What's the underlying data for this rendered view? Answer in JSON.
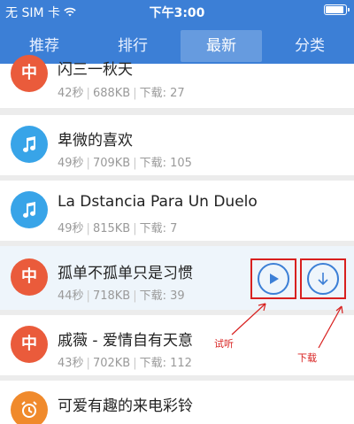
{
  "status_bar": {
    "carrier": "无 SIM 卡",
    "time": "下午3:00",
    "battery_level": 0.9
  },
  "tabs": [
    {
      "label": "推荐",
      "active": false
    },
    {
      "label": "排行",
      "active": false
    },
    {
      "label": "最新",
      "active": true
    },
    {
      "label": "分类",
      "active": false
    }
  ],
  "items": [
    {
      "title": "闪三一秋天",
      "duration": "42秒",
      "size": "688KB",
      "downloads": "下载: 27",
      "icon": "zhong-icon",
      "icon_color": "#ea5b3b"
    },
    {
      "title": "卑微的喜欢",
      "duration": "49秒",
      "size": "709KB",
      "downloads": "下载: 105",
      "icon": "music-note-icon",
      "icon_color": "#38a4e8"
    },
    {
      "title": "La Dstancia Para Un Duelo",
      "duration": "49秒",
      "size": "815KB",
      "downloads": "下载: 7",
      "icon": "music-note-icon",
      "icon_color": "#38a4e8"
    },
    {
      "title": "孤单不孤单只是习惯",
      "duration": "44秒",
      "size": "718KB",
      "downloads": "下载: 39",
      "icon": "zhong-icon",
      "icon_color": "#ea5b3b"
    },
    {
      "title": "戚薇 - 爱情自有天意",
      "duration": "43秒",
      "size": "702KB",
      "downloads": "下载: 112",
      "icon": "zhong-icon",
      "icon_color": "#ea5b3b"
    },
    {
      "title": "可爱有趣的来电彩铃",
      "duration": "",
      "size": "",
      "downloads": "",
      "icon": "alarm-clock-icon",
      "icon_color": "#f08a2c"
    }
  ],
  "icon_glyph_zhong": "中",
  "annotations": {
    "listen": "试听",
    "download": "下载"
  },
  "colors": {
    "header": "#3c7fd6",
    "annotation": "#d8201f"
  }
}
